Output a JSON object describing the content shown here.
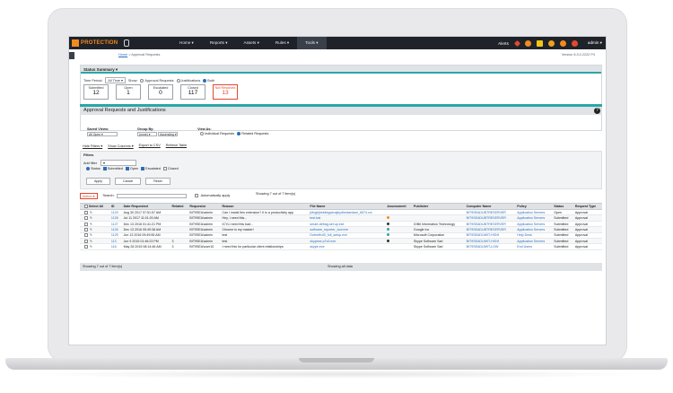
{
  "nav": {
    "brand": "PROTECTION",
    "menu": [
      {
        "label": "Home ▾",
        "active": false
      },
      {
        "label": "Reports ▾",
        "active": false
      },
      {
        "label": "Assets ▾",
        "active": false
      },
      {
        "label": "Rules ▾",
        "active": false
      },
      {
        "label": "Tools ▾",
        "active": true
      }
    ],
    "alerts_label": "Alerts",
    "user": "admin ▾"
  },
  "breadcrumb": {
    "home": "Home",
    "separator": " > ",
    "current": "Approval Requests"
  },
  "version": "Version 8.3.0.2222 P4",
  "status_summary": {
    "header": "Status Summary ▾",
    "time_period_label": "Time Period:",
    "time_period_value": "All Time ▾",
    "show_label": "Show:",
    "show_options": [
      "Approval Requests",
      "Justifications",
      "Both"
    ],
    "show_selected_index": 2,
    "boxes": [
      {
        "label": "Submitted",
        "count": "12",
        "alert": false
      },
      {
        "label": "Open",
        "count": "1",
        "alert": false
      },
      {
        "label": "Escalated",
        "count": "0",
        "alert": false
      },
      {
        "label": "Closed",
        "count": "117",
        "alert": false
      },
      {
        "label": "Not Resolved",
        "count": "13",
        "alert": true
      }
    ]
  },
  "panel": {
    "title": "Approval Requests and Justifications",
    "help": "?"
  },
  "views": {
    "saved_views_label": "Saved Views:",
    "saved_views_value": "All Open ▾",
    "group_by_label": "Group By:",
    "group_by_value": "(none) ▾",
    "group_order_value": "Ascending ▾",
    "view_as_label": "View As:",
    "view_as_options": [
      "Individual Requests",
      "Related Requests"
    ],
    "view_as_selected_index": 1
  },
  "actions": {
    "hide_filters": "Hide Filters ▾",
    "show_columns": "Show Columns ▾",
    "export_csv": "Export to CSV",
    "refresh": "Refresh Table"
  },
  "filters": {
    "label": "Filters",
    "add_filter": "Add filter",
    "status_label": "Status",
    "statuses": [
      "Submitted",
      "Open",
      "Escalated",
      "Closed"
    ],
    "buttons": [
      "Apply",
      "Cancel",
      "Reset"
    ]
  },
  "table_toolbar": {
    "action_button": "Action ▾",
    "search_label": "Search:",
    "auto_apply": "Automatically apply",
    "showing": "Showing 7 out of 7 item(s)"
  },
  "table": {
    "columns": [
      "Select All",
      "ID",
      "Date Requested",
      "Related",
      "Requestor",
      "Reason",
      "File Name",
      "Assessment",
      "Publisher",
      "Computer Name",
      "Policy",
      "Status",
      "Request Type"
    ],
    "rows": [
      [
        "1129",
        "Aug 30 2017 07:51:57 AM",
        "",
        "BIT9SEA\\admin",
        "Can I install this extension? It is a productivity app",
        "jkfngbjhebkbgcenajbydhedaedam_6574.crx",
        "",
        "",
        "BIT9SEADUBTRESERVER",
        "Application Servers",
        "Open",
        "Approval"
      ],
      [
        "1128",
        "Jul 11 2017 11:01:20 AM",
        "",
        "BIT9SEA\\admin",
        "Hey, I need this...",
        "test.bat",
        "orange",
        "",
        "BIT9SEADUBTRESERVER",
        "Application Servers",
        "Submitted",
        "Approval"
      ],
      [
        "1127",
        "Dec 13 2016 01:41:21 PM",
        "",
        "BIT9SEA\\admin",
        "ICYLI need this bad...",
        "smart-defrag-set.up.exe",
        "dark",
        "IOBit Information Technology",
        "BIT9SEADUBTRESERVER",
        "Application Servers",
        "Submitted",
        "Approval"
      ],
      [
        "1126",
        "Dec 13 2016 05:49:38 AM",
        "",
        "BIT9SEA\\admin",
        "Chrome is my master!",
        "software_reporter_tool.exe",
        "teal",
        "Google Inc",
        "BIT9SEADUBTRESERVER",
        "Application Servers",
        "Submitted",
        "Approval"
      ],
      [
        "1125",
        "Jun 13 2016 09:49:55 AM",
        "",
        "BIT9SEA\\admin",
        "test",
        "Dotnetfx40_full_setup.exe",
        "teal",
        "Microsoft Corporation",
        "BIT9SEADUWIT-HIGH",
        "Help Desk",
        "Submitted",
        "Approval"
      ],
      [
        "113",
        "Jun 9 2015 01:46:23 PM",
        "3",
        "BIT9SEA\\admin",
        "test",
        "skypese.p7z3.exe",
        "dark",
        "Skype Software Sarl",
        "BIT9SEADUWIT-HIGH",
        "Application Servers",
        "Submitted",
        "Approval"
      ],
      [
        "116",
        "May 28 2015 08:14:46 AM",
        "3",
        "BIT9SEA\\user10",
        "I need this for particular client relationships",
        "skype.exe",
        "",
        "Skype Software Sarl",
        "BIT9SEADUWIT-LOW",
        "End Users",
        "Submitted",
        "Approval"
      ]
    ]
  },
  "footer": {
    "left": "Showing 7 out of 7 item(s)",
    "center": "Showing all data"
  },
  "colors": {
    "accent": "#2aa6a6",
    "brand": "#f28a1e",
    "alert": "#e2492f",
    "link": "#2a6ebb",
    "assess_orange": "#f28a1e",
    "assess_dark": "#333333",
    "assess_teal": "#2aa6a6"
  }
}
